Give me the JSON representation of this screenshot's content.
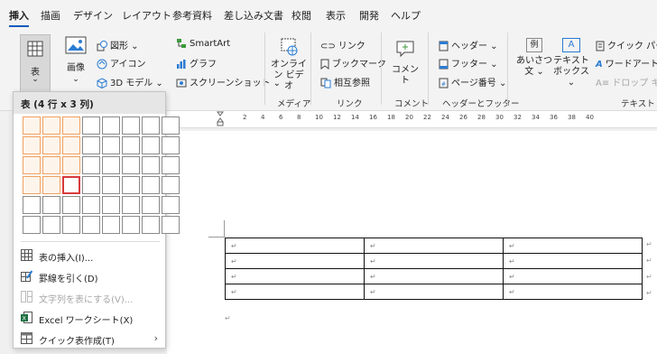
{
  "menu": {
    "tabs": [
      "挿入",
      "描画",
      "デザイン",
      "レイアウト",
      "参考資料",
      "差し込み文書",
      "校閲",
      "表示",
      "開発",
      "ヘルプ"
    ],
    "active": "挿入"
  },
  "ribbon": {
    "table_label": "表",
    "image_label": "画像",
    "shapes": "図形",
    "icons": "アイコン",
    "model3d": "3D モデル",
    "smartart": "SmartArt",
    "graph": "グラフ",
    "screenshot": "スクリーンショット",
    "online_video_line1": "オンライ",
    "online_video_line2": "ン ビデオ",
    "media_group": "メディア",
    "link": "リンク",
    "bookmark": "ブックマーク",
    "crossref": "相互参照",
    "link_group": "リンク",
    "comment": "コメント",
    "comment_group": "コメント",
    "header": "ヘッダー",
    "footer": "フッター",
    "page_number": "ページ番号",
    "header_footer_group": "ヘッダーとフッター",
    "greeting_box": "例",
    "greeting_line1": "あいさつ",
    "greeting_line2": "文",
    "textbox_line1": "テキスト",
    "textbox_line2": "ボックス",
    "quick_parts": "クイック パーツ",
    "wordart": "ワードアート",
    "dropcap": "ドロップ キャップ",
    "text_group": "テキスト"
  },
  "ruler": {
    "numbers": [
      "2",
      "4",
      "6",
      "8",
      "10",
      "12",
      "14",
      "16",
      "18",
      "20",
      "22",
      "24",
      "26",
      "28",
      "30",
      "32",
      "34",
      "36",
      "38",
      "40"
    ]
  },
  "dropdown": {
    "title": "表 (4 行 x 3 列)",
    "items": {
      "insert_table": "表の挿入(I)...",
      "draw_table": "罫線を引く(D)",
      "text_to_table": "文字列を表にする(V)...",
      "excel_sheet": "Excel ワークシート(X)",
      "quick_tables": "クイック表作成(T)"
    }
  },
  "document": {
    "paragraph_mark": "↵"
  }
}
